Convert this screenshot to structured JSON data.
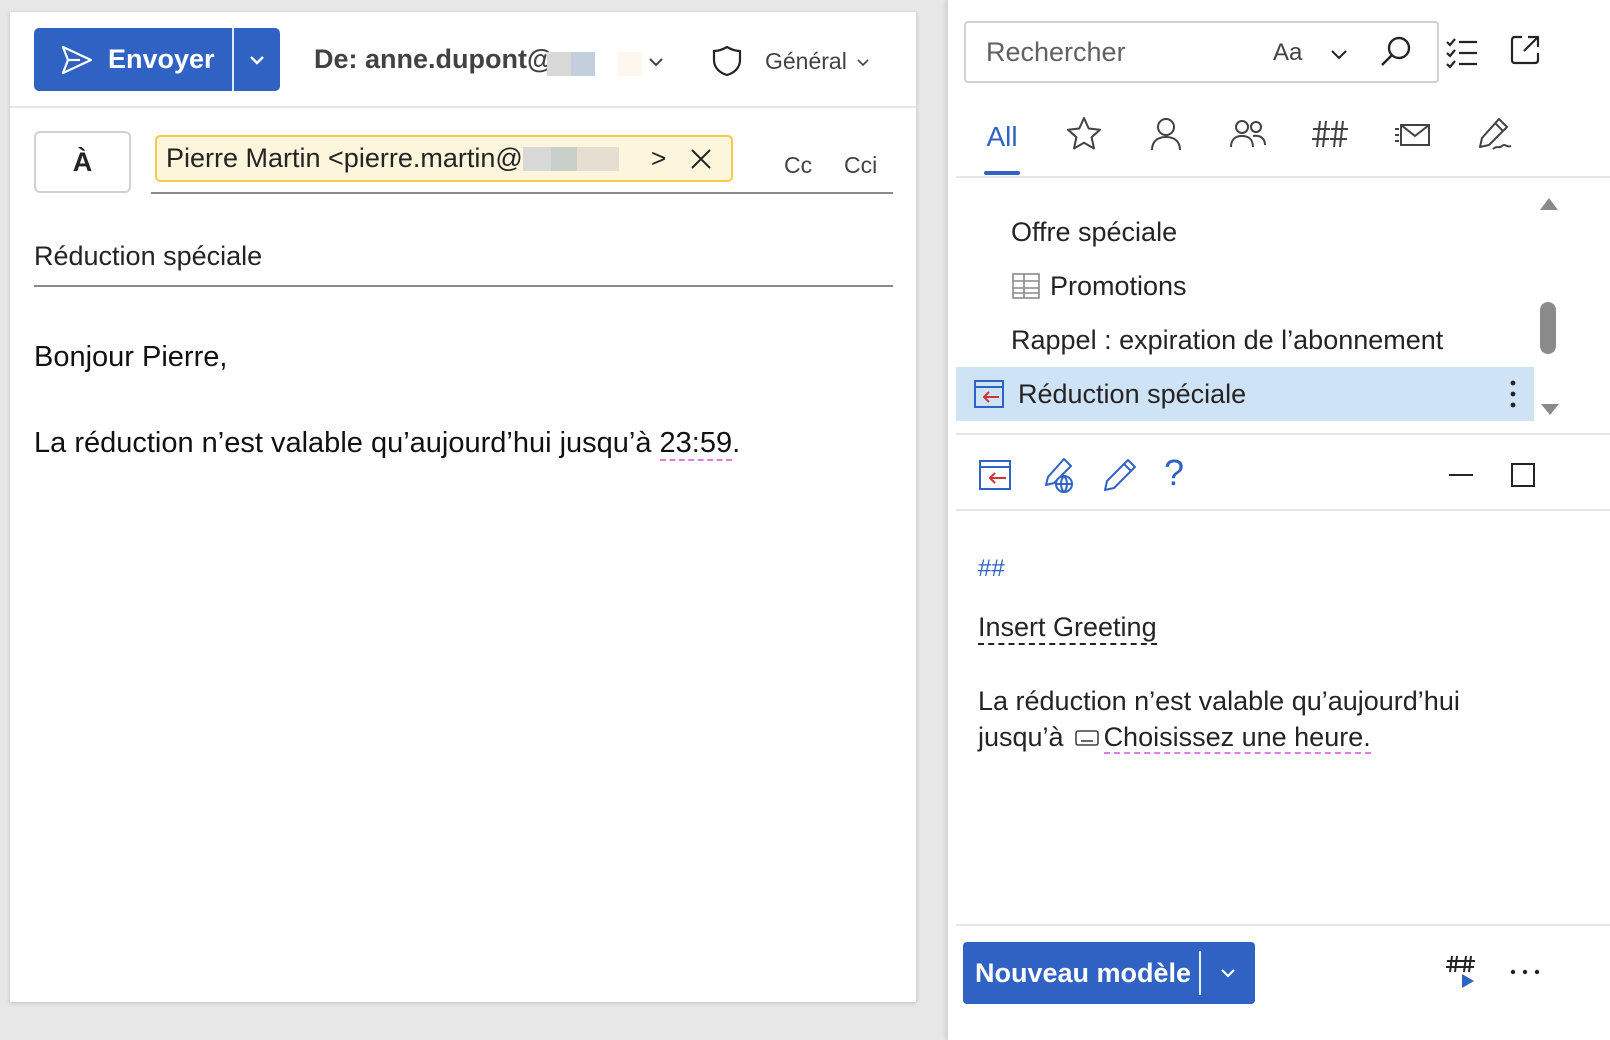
{
  "compose": {
    "send_label": "Envoyer",
    "from_label": "De: anne.dupont@",
    "sensitivity_label": "Général",
    "to_label": "À",
    "recipient": "Pierre Martin <pierre.martin@",
    "recipient_expand": ">",
    "cc_label": "Cc",
    "bcc_label": "Cci",
    "subject": "Réduction spéciale",
    "body": {
      "greeting": "Bonjour Pierre,",
      "line_before_time": "La réduction n’est valable qu’aujourd’hui jusqu’à ",
      "time": "23:59",
      "line_after_time": "."
    }
  },
  "templates_pane": {
    "search_placeholder": "Rechercher",
    "match_case_label": "Aa",
    "tabs": {
      "all_label": "All"
    },
    "items": [
      {
        "label": "Offre spéciale"
      },
      {
        "label": "Promotions"
      },
      {
        "label": "Rappel : expiration de l’abonnement"
      },
      {
        "label": "Réduction spéciale",
        "selected": true
      }
    ],
    "help_label": "?",
    "preview": {
      "hash": "##",
      "greeting_field": "Insert Greeting",
      "text_before": "La réduction n’est valable qu’aujourd’hui jusqu’à",
      "time_field": "Choisissez une heure."
    },
    "new_template_label": "Nouveau modèle"
  },
  "colors": {
    "accent": "#2f62c3",
    "selected_item": "#cfe3f6",
    "recipient_chip": "#fdf6dc",
    "recipient_chip_border": "#f3cc4b",
    "field_underline": "#e07ce8"
  },
  "icons": [
    "send-icon",
    "chevron-down-icon",
    "shield-icon",
    "close-icon",
    "search-icon",
    "tasklist-icon",
    "popout-icon",
    "star-icon",
    "person-icon",
    "people-icon",
    "hash-icon",
    "mail-stack-icon",
    "signature-icon",
    "table-icon",
    "insert-template-icon",
    "share-template-icon",
    "pencil-icon",
    "minimize-icon",
    "maximize-icon",
    "more-vertical-icon",
    "more-horizontal-icon",
    "run-hash-icon"
  ]
}
